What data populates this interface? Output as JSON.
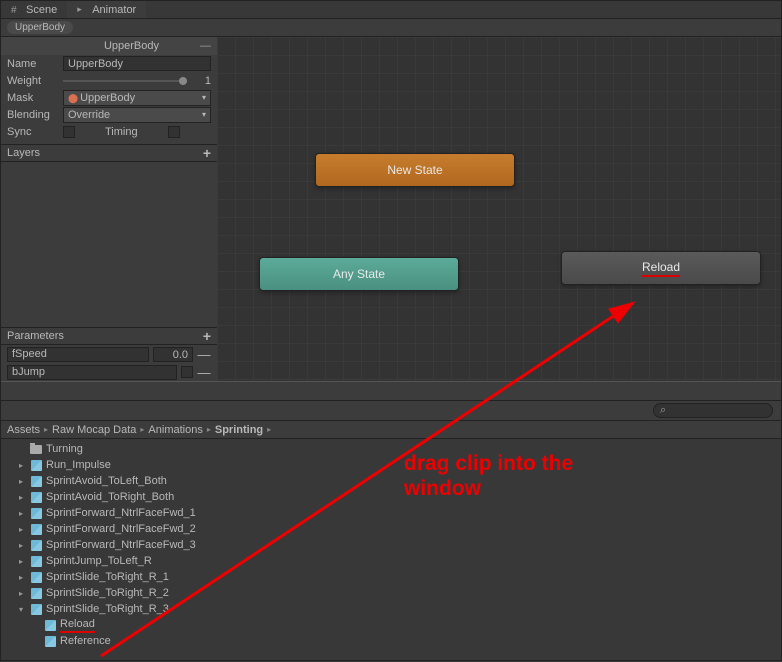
{
  "tabs": {
    "scene": "Scene",
    "animator": "Animator"
  },
  "breadcrumb": {
    "layer": "UpperBody"
  },
  "inspector": {
    "title": "UpperBody",
    "name_label": "Name",
    "name_value": "UpperBody",
    "weight_label": "Weight",
    "weight_value": "1",
    "mask_label": "Mask",
    "mask_value": "UpperBody",
    "blending_label": "Blending",
    "blending_value": "Override",
    "sync_label": "Sync",
    "timing_label": "Timing"
  },
  "layers_header": "Layers",
  "params_header": "Parameters",
  "params": [
    {
      "name": "fSpeed",
      "value": "0.0",
      "type": "float"
    },
    {
      "name": "bJump",
      "value": "",
      "type": "bool"
    }
  ],
  "nodes": {
    "new_state": "New State",
    "any_state": "Any State",
    "reload": "Reload"
  },
  "annotation": {
    "text_line1": "drag clip into the",
    "text_line2": "window"
  },
  "project": {
    "breadcrumb": [
      "Assets",
      "Raw Mocap Data",
      "Animations",
      "Sprinting"
    ],
    "items": [
      {
        "name": "Turning",
        "type": "folder",
        "indent": 1,
        "arrow": ""
      },
      {
        "name": "Run_Impulse",
        "type": "anim",
        "indent": 1,
        "arrow": "▸"
      },
      {
        "name": "SprintAvoid_ToLeft_Both",
        "type": "anim",
        "indent": 1,
        "arrow": "▸"
      },
      {
        "name": "SprintAvoid_ToRight_Both",
        "type": "anim",
        "indent": 1,
        "arrow": "▸"
      },
      {
        "name": "SprintForward_NtrlFaceFwd_1",
        "type": "anim",
        "indent": 1,
        "arrow": "▸"
      },
      {
        "name": "SprintForward_NtrlFaceFwd_2",
        "type": "anim",
        "indent": 1,
        "arrow": "▸"
      },
      {
        "name": "SprintForward_NtrlFaceFwd_3",
        "type": "anim",
        "indent": 1,
        "arrow": "▸"
      },
      {
        "name": "SprintJump_ToLeft_R",
        "type": "anim",
        "indent": 1,
        "arrow": "▸"
      },
      {
        "name": "SprintSlide_ToRight_R_1",
        "type": "anim",
        "indent": 1,
        "arrow": "▸"
      },
      {
        "name": "SprintSlide_ToRight_R_2",
        "type": "anim",
        "indent": 1,
        "arrow": "▸"
      },
      {
        "name": "SprintSlide_ToRight_R_3",
        "type": "anim",
        "indent": 1,
        "arrow": "▾"
      },
      {
        "name": "Reload",
        "type": "anim",
        "indent": 2,
        "arrow": "",
        "underline": true
      },
      {
        "name": "Reference",
        "type": "anim",
        "indent": 2,
        "arrow": ""
      }
    ]
  }
}
